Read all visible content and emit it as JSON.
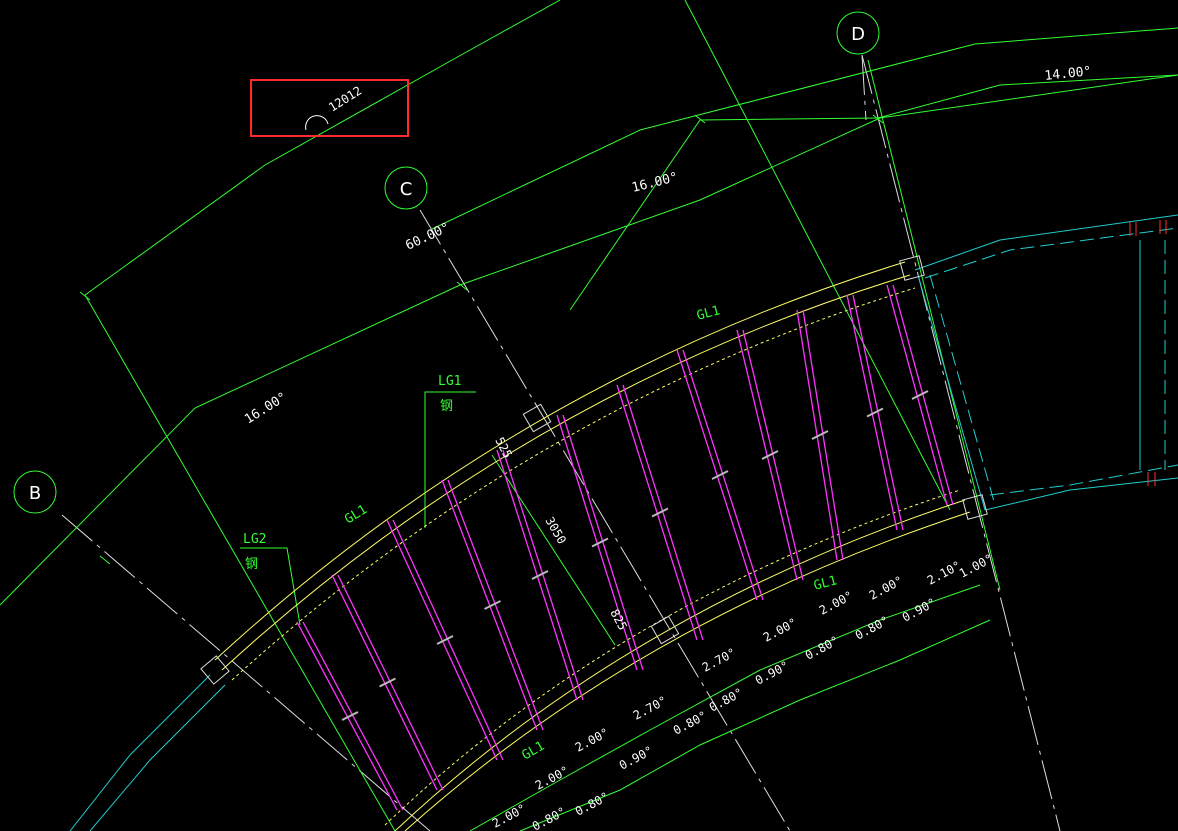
{
  "axes": [
    "B",
    "C",
    "D"
  ],
  "highlight_text": "12012",
  "angles": {
    "a_14": "14.00°",
    "a_16_top": "16.00°",
    "a_60": "60.00°",
    "a_16_left": "16.00°"
  },
  "members": {
    "gl1_top": "GL1",
    "gl1_left": "GL1",
    "gl1_right": "GL1",
    "gl1_bottom": "GL1",
    "lg1_code": "LG1",
    "lg1_note": "钢",
    "lg2_code": "LG2",
    "lg2_note": "钢"
  },
  "dims": {
    "d525": "525",
    "d3050": "3050",
    "d825": "825"
  },
  "outer_angles": [
    "2.00°",
    "2.00°",
    "2.00°",
    "2.70°",
    "2.70°",
    "2.00°",
    "2.00°",
    "2.00°",
    "2.10°",
    "1.00°"
  ],
  "inner_angles": [
    "0.80°",
    "0.80°",
    "0.90°",
    "0.80°",
    "0.80°",
    "0.90°",
    "0.80°",
    "0.80°",
    "0.90°"
  ],
  "colors": {
    "axis_line": "#ffffff",
    "grid": "#33ff33",
    "beam": "#ffff66",
    "stud": "#ff33ff",
    "wall": "#22cccc",
    "highlight": "#ff2a2a"
  }
}
